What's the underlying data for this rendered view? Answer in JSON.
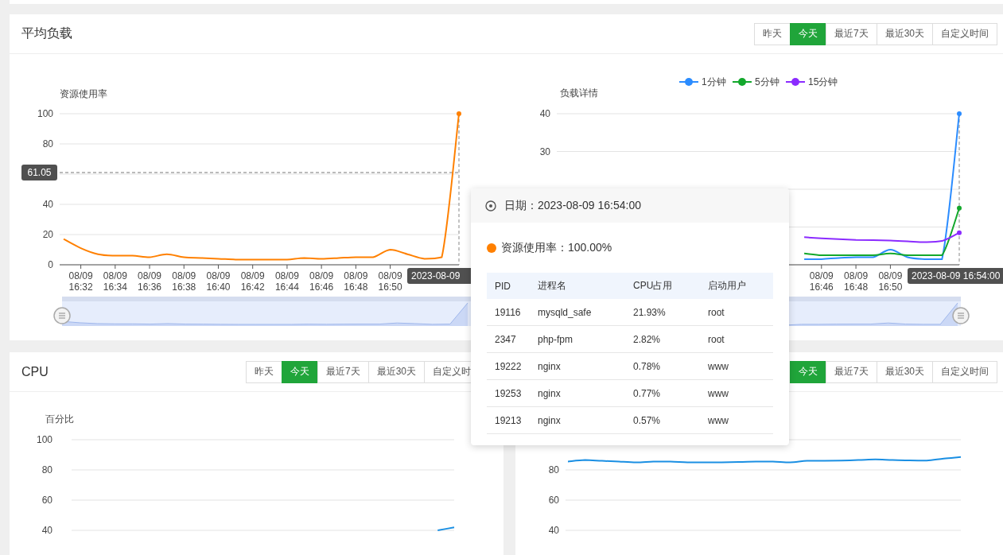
{
  "load_panel": {
    "title": "平均负载",
    "range_buttons": [
      {
        "label": "昨天",
        "selected": false
      },
      {
        "label": "今天",
        "selected": true
      },
      {
        "label": "最近7天",
        "selected": false
      },
      {
        "label": "最近30天",
        "selected": false
      },
      {
        "label": "自定义时间",
        "selected": false
      }
    ],
    "usage_chart": {
      "chart_data": {
        "type": "line",
        "ylabel": "资源使用率",
        "ylim": [
          0,
          100
        ],
        "grid": true,
        "yticks": [
          0,
          20,
          40,
          80,
          100
        ],
        "categories": [
          null,
          "08/09 16:32",
          null,
          "08/09 16:34",
          null,
          "08/09 16:36",
          null,
          "08/09 16:38",
          null,
          "08/09 16:40",
          null,
          "08/09 16:42",
          null,
          "08/09 16:44",
          null,
          "08/09 16:46",
          null,
          "08/09 16:48",
          null,
          "08/09 16:50",
          null,
          null,
          null,
          null
        ],
        "series": [
          {
            "color": "#ff8000",
            "values": [
              17,
              11,
              7,
              6,
              6,
              5,
              7,
              5,
              4.5,
              4,
              3.5,
              3.5,
              3.5,
              3.5,
              4.5,
              4,
              4.5,
              5,
              5,
              10,
              7,
              4,
              5,
              100
            ]
          }
        ],
        "ref_lines": [
          {
            "axis": "y",
            "value": 61.05,
            "label": "61.05"
          }
        ]
      },
      "pointer_label": "2023-08-09"
    },
    "detail_chart": {
      "chart_data": {
        "type": "line",
        "ylabel": "负载详情",
        "ylim": [
          0,
          40
        ],
        "grid": true,
        "yticks": [
          30,
          40
        ],
        "legend": "top",
        "categories": [
          null,
          null,
          null,
          null,
          null,
          null,
          null,
          null,
          null,
          null,
          null,
          null,
          null,
          null,
          null,
          "08/09 16:46",
          null,
          "08/09 16:48",
          null,
          "08/09 16:50",
          null,
          null,
          null,
          null
        ],
        "series": [
          {
            "name": "1分钟",
            "color": "#2b8cff",
            "values": [
              null,
              null,
              null,
              null,
              null,
              null,
              null,
              null,
              null,
              null,
              null,
              null,
              null,
              null,
              1.5,
              1.5,
              1.8,
              2,
              2,
              4,
              2,
              1.5,
              1.5,
              40
            ]
          },
          {
            "name": "5分钟",
            "color": "#13a82c",
            "values": [
              null,
              null,
              null,
              null,
              null,
              null,
              null,
              null,
              null,
              null,
              null,
              null,
              null,
              null,
              3,
              2.5,
              2.5,
              2.5,
              2.5,
              3,
              2.5,
              2.5,
              2.5,
              15
            ]
          },
          {
            "name": "15分钟",
            "color": "#8b2bff",
            "values": [
              null,
              null,
              null,
              null,
              null,
              null,
              null,
              null,
              null,
              null,
              null,
              null,
              null,
              null,
              7.3,
              7,
              6.8,
              6.6,
              6.5,
              6.4,
              6.2,
              6,
              6.3,
              8.5
            ]
          }
        ]
      },
      "pointer_label": "2023-08-09 16:54:00"
    }
  },
  "cpu_panel": {
    "title": "CPU",
    "range_buttons": [
      {
        "label": "昨天",
        "selected": false
      },
      {
        "label": "今天",
        "selected": true
      },
      {
        "label": "最近7天",
        "selected": false
      },
      {
        "label": "最近30天",
        "selected": false
      },
      {
        "label": "自定义时",
        "selected": false
      }
    ],
    "chart": {
      "chart_data": {
        "type": "line",
        "ylabel": "百分比",
        "ylim": [
          40,
          100
        ],
        "grid": true,
        "yticks": [
          40,
          60,
          80,
          100
        ],
        "series": [
          {
            "color": "#1a8fe3",
            "values": [
              null,
              null,
              null,
              null,
              null,
              null,
              null,
              null,
              null,
              null,
              null,
              null,
              null,
              null,
              null,
              null,
              null,
              null,
              null,
              null,
              null,
              null,
              40,
              42
            ]
          }
        ]
      }
    }
  },
  "memory_panel": {
    "range_buttons": [
      {
        "label": "今天",
        "selected": true
      },
      {
        "label": "最近7天",
        "selected": false
      },
      {
        "label": "最近30天",
        "selected": false
      },
      {
        "label": "自定义时间",
        "selected": false
      }
    ],
    "chart": {
      "chart_data": {
        "type": "line",
        "ylim": [
          40,
          100
        ],
        "grid": true,
        "yticks": [
          40,
          60,
          80
        ],
        "series": [
          {
            "color": "#1a8fe3",
            "values": [
              85.5,
              86.5,
              86,
              85.5,
              85,
              85.5,
              85.5,
              85,
              85,
              85,
              85.2,
              85.5,
              85.5,
              85,
              86,
              86,
              86.2,
              86.5,
              87,
              86.5,
              86.3,
              86.2,
              87.5,
              88.5
            ]
          }
        ]
      }
    }
  },
  "tooltip": {
    "date_label": "日期：2023-08-09 16:54:00",
    "series": {
      "label": "资源使用率：100.00%",
      "color": "#ff8000"
    },
    "table": {
      "columns": [
        "PID",
        "进程名",
        "CPU占用",
        "启动用户"
      ],
      "rows": [
        [
          "19116",
          "mysqld_safe",
          "21.93%",
          "root"
        ],
        [
          "2347",
          "php-fpm",
          "2.82%",
          "root"
        ],
        [
          "19222",
          "nginx",
          "0.78%",
          "www"
        ],
        [
          "19253",
          "nginx",
          "0.77%",
          "www"
        ],
        [
          "19213",
          "nginx",
          "0.57%",
          "www"
        ]
      ]
    }
  }
}
